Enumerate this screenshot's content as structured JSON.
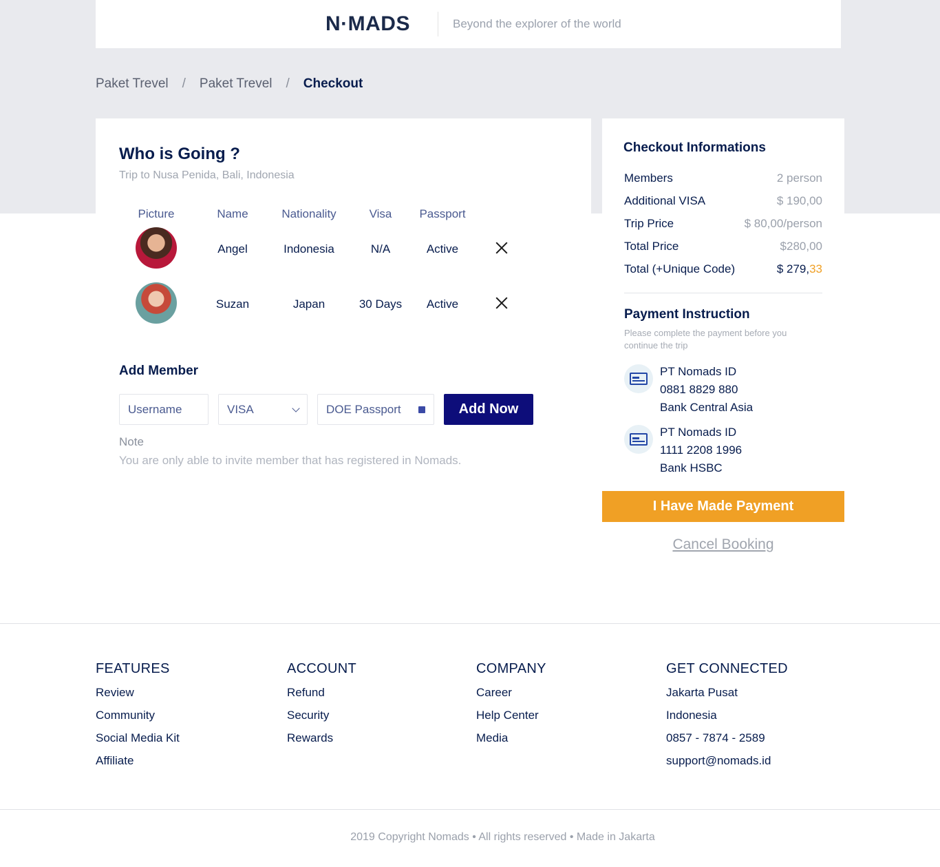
{
  "header": {
    "logo": "N·MADS",
    "tagline": "Beyond the explorer of the world"
  },
  "breadcrumb": {
    "items": [
      "Paket Trevel",
      "Paket Trevel",
      "Checkout"
    ],
    "separator": "/"
  },
  "who": {
    "title": "Who is Going ?",
    "subtitle": "Trip to Nusa Penida, Bali, Indonesia",
    "columns": [
      "Picture",
      "Name",
      "Nationality",
      "Visa",
      "Passport"
    ],
    "members": [
      {
        "name": "Angel",
        "nationality": "Indonesia",
        "visa": "N/A",
        "passport": "Active"
      },
      {
        "name": "Suzan",
        "nationality": "Japan",
        "visa": "30 Days",
        "passport": "Active"
      }
    ]
  },
  "add_member": {
    "title": "Add Member",
    "username_placeholder": "Username",
    "visa_value": "VISA",
    "passport_placeholder": "DOE Passport",
    "button": "Add Now",
    "note_label": "Note",
    "note_text": "You are only able to invite member that has registered in Nomads."
  },
  "checkout": {
    "title": "Checkout Informations",
    "rows": [
      {
        "label": "Members",
        "value": "2 person"
      },
      {
        "label": "Additional VISA",
        "value": "$ 190,00"
      },
      {
        "label": "Trip Price",
        "value": "$ 80,00/person"
      },
      {
        "label": "Total Price",
        "value": "$280,00"
      },
      {
        "label": "Total (+Unique Code)",
        "value_main": "$ 279,",
        "value_accent": "33"
      }
    ]
  },
  "payment": {
    "title": "Payment Instruction",
    "subtitle": "Please complete the payment before you continue the trip",
    "banks": [
      {
        "name": "PT Nomads ID",
        "number": "0881 8829 880",
        "bank": "Bank Central Asia"
      },
      {
        "name": "PT Nomads ID",
        "number": "1111 2208 1996",
        "bank": "Bank HSBC"
      }
    ],
    "pay_button": "I Have Made Payment",
    "cancel_link": "Cancel Booking"
  },
  "colors": {
    "primary": "#071c4d",
    "button_dark": "#0d0d7a",
    "accent": "#f0a025",
    "background_band": "#e9eaee"
  },
  "footer": {
    "columns": [
      {
        "title": "FEATURES",
        "links": [
          "Review",
          "Community",
          "Social Media Kit",
          "Affiliate"
        ]
      },
      {
        "title": "ACCOUNT",
        "links": [
          "Refund",
          "Security",
          "Rewards"
        ]
      },
      {
        "title": "COMPANY",
        "links": [
          "Career",
          "Help Center",
          "Media"
        ]
      },
      {
        "title": "GET CONNECTED",
        "links": [
          "Jakarta Pusat",
          "Indonesia",
          "0857 - 7874 - 2589",
          "support@nomads.id"
        ]
      }
    ],
    "copyright": "2019 Copyright Nomads • All rights reserved • Made in Jakarta"
  }
}
